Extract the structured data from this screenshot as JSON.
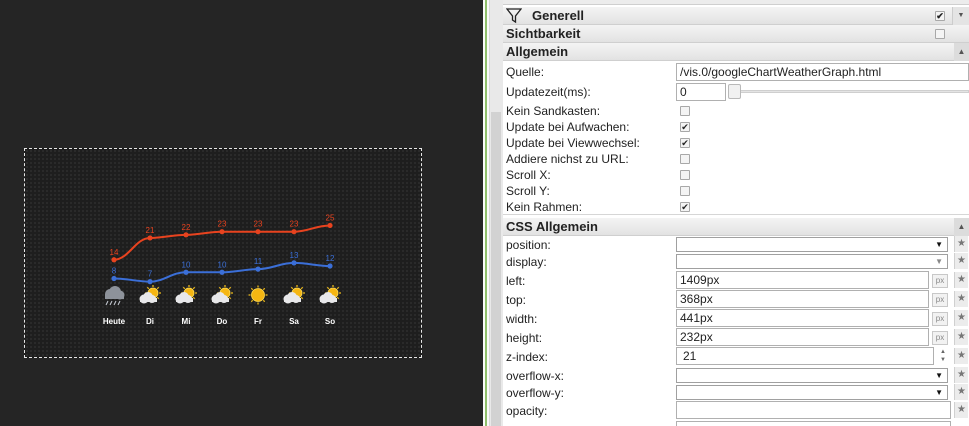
{
  "widget": {
    "days": [
      "Heute",
      "Di",
      "Mi",
      "Do",
      "Fr",
      "Sa",
      "So"
    ],
    "high": [
      14,
      21,
      22,
      23,
      23,
      23,
      25
    ],
    "low": [
      8,
      7,
      10,
      10,
      11,
      13,
      12
    ],
    "weather_icons": [
      "storm-cloud-icon",
      "sun-cloud-icon",
      "sun-cloud-icon",
      "sun-cloud-icon",
      "sun-icon",
      "sun-cloud-icon",
      "sun-cloud-icon"
    ],
    "colors": {
      "high": "#e8431f",
      "low": "#3b6fd8",
      "label_text": "#ffffff"
    }
  },
  "panel": {
    "groups": {
      "generell": "Generell",
      "sichtbarkeit": "Sichtbarkeit",
      "allgemein": "Allgemein",
      "css_allgemein": "CSS Allgemein"
    },
    "generell_checked": true,
    "sichtbarkeit_checked": false,
    "allgemein": {
      "quelle_label": "Quelle:",
      "quelle_value": "/vis.0/googleChartWeatherGraph.html",
      "updatezeit_label": "Updatezeit(ms):",
      "updatezeit_value": "0",
      "checks": [
        {
          "label": "Kein Sandkasten:",
          "checked": false
        },
        {
          "label": "Update bei Aufwachen:",
          "checked": true
        },
        {
          "label": "Update bei Viewwechsel:",
          "checked": true
        },
        {
          "label": "Addiere nichst zu URL:",
          "checked": false
        },
        {
          "label": "Scroll X:",
          "checked": false
        },
        {
          "label": "Scroll Y:",
          "checked": false
        },
        {
          "label": "Kein Rahmen:",
          "checked": true
        }
      ]
    },
    "css": {
      "position_label": "position:",
      "display_label": "display:",
      "left_label": "left:",
      "left_value": "1409px",
      "top_label": "top:",
      "top_value": "368px",
      "width_label": "width:",
      "width_value": "441px",
      "height_label": "height:",
      "height_value": "232px",
      "zindex_label": "z-index:",
      "zindex_value": "21",
      "overflowx_label": "overflow-x:",
      "overflowy_label": "overflow-y:",
      "opacity_label": "opacity:",
      "unit": "px"
    }
  }
}
